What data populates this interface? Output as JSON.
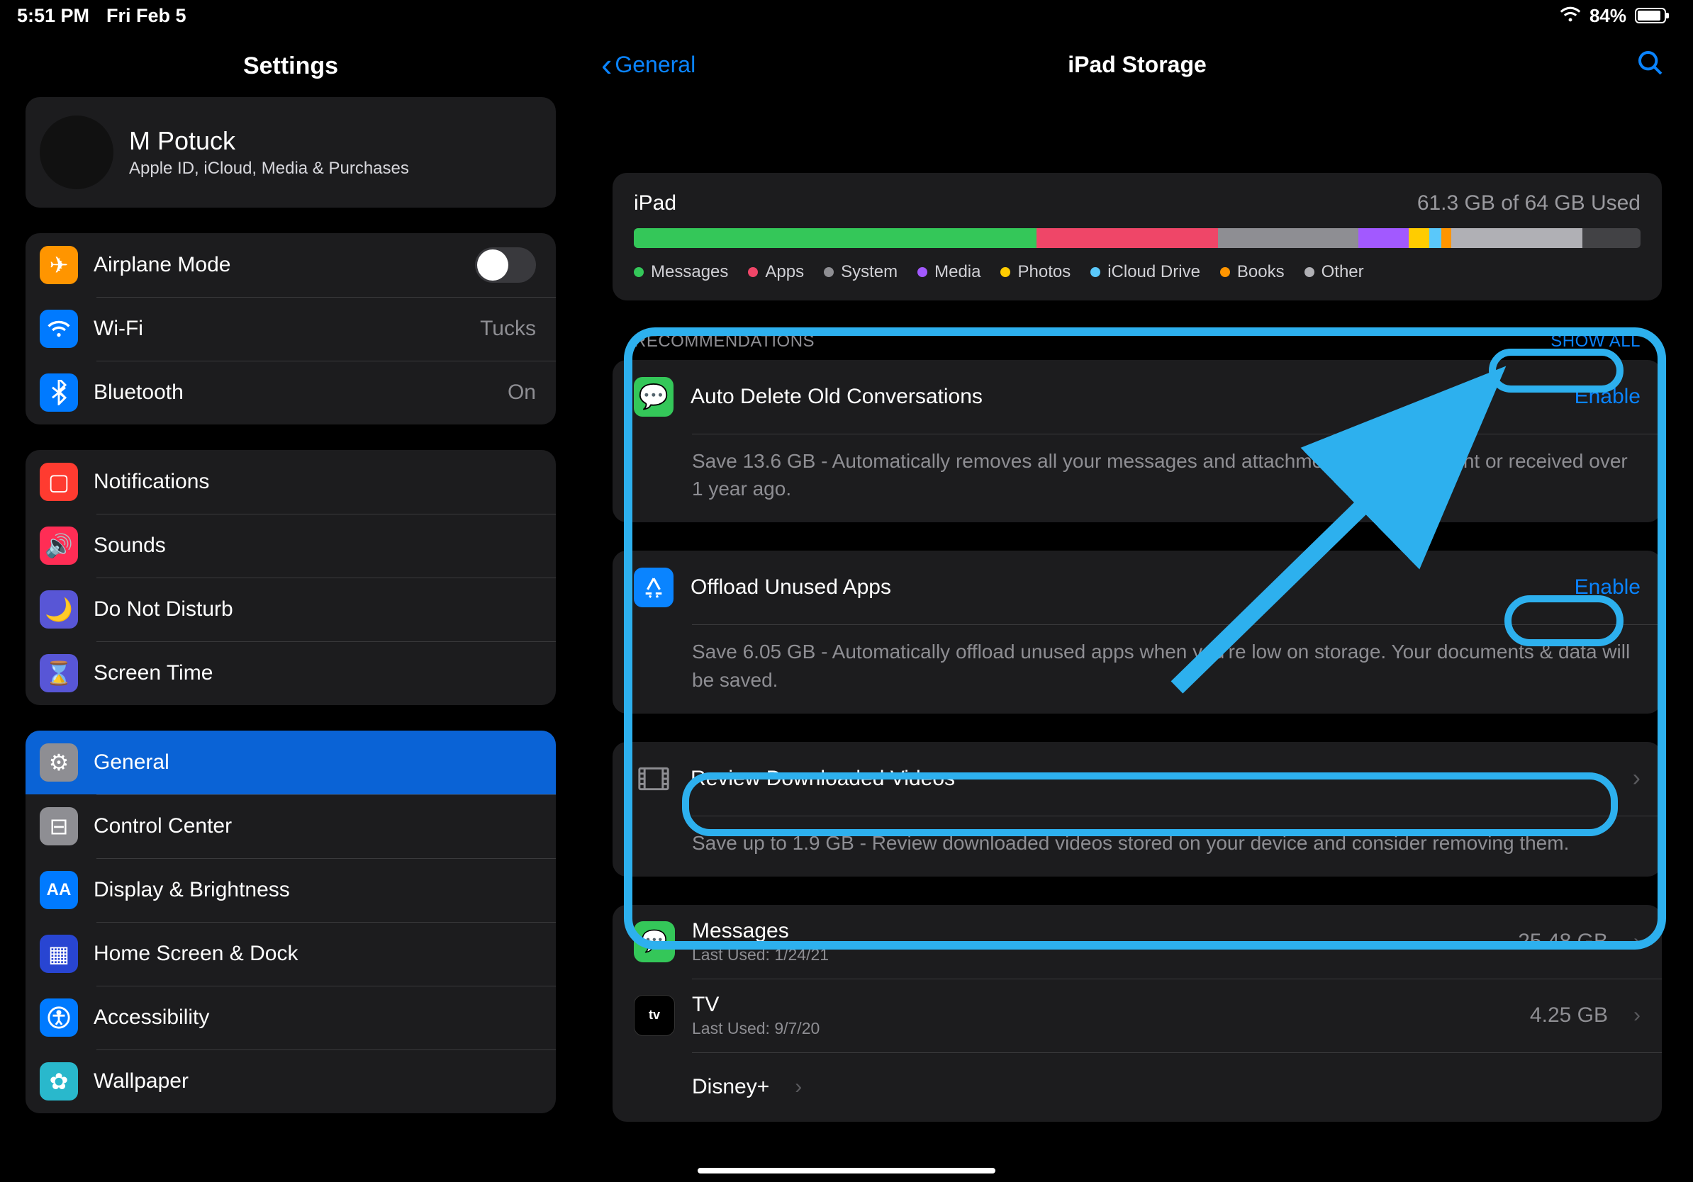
{
  "status": {
    "time": "5:51 PM",
    "date": "Fri Feb 5",
    "battery_pct": "84%",
    "battery_fill_pct": 84
  },
  "sidebar": {
    "title": "Settings",
    "profile": {
      "name": "M Potuck",
      "subtitle": "Apple ID, iCloud, Media & Purchases"
    },
    "group1": {
      "airplane": "Airplane Mode",
      "wifi": {
        "label": "Wi-Fi",
        "value": "Tucks"
      },
      "bluetooth": {
        "label": "Bluetooth",
        "value": "On"
      }
    },
    "group2": {
      "notifications": "Notifications",
      "sounds": "Sounds",
      "dnd": "Do Not Disturb",
      "screentime": "Screen Time"
    },
    "group3": {
      "general": "General",
      "control": "Control Center",
      "display": "Display & Brightness",
      "home": "Home Screen & Dock",
      "accessibility": "Accessibility",
      "wallpaper": "Wallpaper"
    }
  },
  "detail": {
    "back": "General",
    "title": "iPad Storage",
    "storage": {
      "device": "iPad",
      "used_text": "61.3 GB of 64 GB Used",
      "segments": [
        {
          "label": "Messages",
          "color": "#34c759",
          "pct": 40
        },
        {
          "label": "Apps",
          "color": "#ef4668",
          "pct": 18
        },
        {
          "label": "System",
          "color": "#8e8e93",
          "pct": 14
        },
        {
          "label": "Media",
          "color": "#a259ff",
          "pct": 5
        },
        {
          "label": "Photos",
          "color": "#ffcc00",
          "pct": 2
        },
        {
          "label": "iCloud Drive",
          "color": "#5ac8fa",
          "pct": 1.2
        },
        {
          "label": "Books",
          "color": "#ff9500",
          "pct": 1
        },
        {
          "label": "Other",
          "color": "#b0b0b5",
          "pct": 13
        }
      ]
    },
    "rec_header": {
      "label": "Recommendations",
      "showall": "SHOW ALL"
    },
    "rec1": {
      "title": "Auto Delete Old Conversations",
      "action": "Enable",
      "desc": "Save 13.6 GB - Automatically removes all your messages and attachments that were sent or received over 1 year ago."
    },
    "rec2": {
      "title": "Offload Unused Apps",
      "action": "Enable",
      "desc": "Save 6.05 GB - Automatically offload unused apps when you're low on storage. Your documents & data will be saved."
    },
    "rec3": {
      "title": "Review Downloaded Videos",
      "desc": "Save up to 1.9 GB - Review downloaded videos stored on your device and consider removing them."
    },
    "apps": [
      {
        "name": "Messages",
        "sub": "Last Used: 1/24/21",
        "size": "25.48 GB",
        "icon": "messages"
      },
      {
        "name": "TV",
        "sub": "Last Used: 9/7/20",
        "size": "4.25 GB",
        "icon": "tv"
      },
      {
        "name": "Disney+",
        "sub": "",
        "size": "",
        "icon": ""
      }
    ]
  }
}
